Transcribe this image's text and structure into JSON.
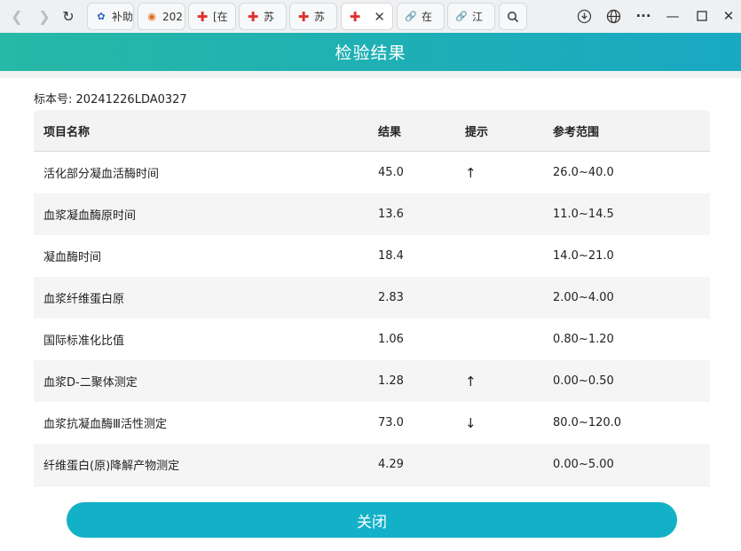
{
  "browser": {
    "tabs": [
      {
        "label": "补助",
        "icon": "hospital-logo-icon"
      },
      {
        "label": "202",
        "icon": "org-logo-icon"
      },
      {
        "label": "[在",
        "icon": "red-cross-icon"
      },
      {
        "label": "苏",
        "icon": "red-cross-icon"
      },
      {
        "label": "苏",
        "icon": "red-cross-icon"
      },
      {
        "label": "",
        "icon": "red-cross-icon",
        "active": true
      },
      {
        "label": "在",
        "icon": "link-icon"
      },
      {
        "label": "江",
        "icon": "link-icon"
      }
    ]
  },
  "page": {
    "title": "检验结果",
    "specimen_label": "标本号:",
    "specimen_value": "20241226LDA0327",
    "close_label": "关闭"
  },
  "table": {
    "headers": [
      "项目名称",
      "结果",
      "提示",
      "参考范围"
    ],
    "rows": [
      {
        "name": "活化部分凝血活酶时间",
        "result": "45.0",
        "hint": "↑",
        "range": "26.0~40.0"
      },
      {
        "name": "血浆凝血酶原时间",
        "result": "13.6",
        "hint": "",
        "range": "11.0~14.5"
      },
      {
        "name": "凝血酶时间",
        "result": "18.4",
        "hint": "",
        "range": "14.0~21.0"
      },
      {
        "name": "血浆纤维蛋白原",
        "result": "2.83",
        "hint": "",
        "range": "2.00~4.00"
      },
      {
        "name": "国际标准化比值",
        "result": "1.06",
        "hint": "",
        "range": "0.80~1.20"
      },
      {
        "name": "血浆D-二聚体测定",
        "result": "1.28",
        "hint": "↑",
        "range": "0.00~0.50"
      },
      {
        "name": "血浆抗凝血酶Ⅲ活性测定",
        "result": "73.0",
        "hint": "↓",
        "range": "80.0~120.0"
      },
      {
        "name": "纤维蛋白(原)降解产物测定",
        "result": "4.29",
        "hint": "",
        "range": "0.00~5.00"
      }
    ]
  },
  "colors": {
    "header_start": "#27b8a6",
    "header_end": "#18a9c3",
    "button": "#12b1c8"
  }
}
